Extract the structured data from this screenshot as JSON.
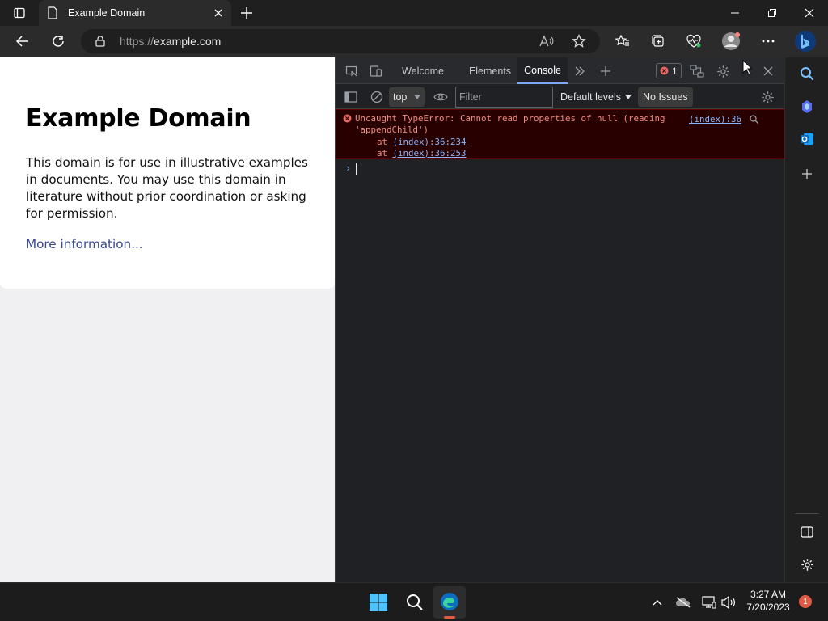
{
  "browser": {
    "tab_title": "Example Domain",
    "url_protocol": "https://",
    "url_host": "example.com"
  },
  "page": {
    "heading": "Example Domain",
    "paragraph": "This domain is for use in illustrative examples in documents. You may use this domain in literature without prior coordination or asking for permission.",
    "link": "More information..."
  },
  "devtools": {
    "tabs": [
      {
        "label": "Welcome"
      },
      {
        "label": "Elements"
      },
      {
        "label": "Console",
        "active": true
      }
    ],
    "error_count": "1",
    "context": "top",
    "filter_placeholder": "Filter",
    "levels_label": "Default levels",
    "issues_label": "No Issues",
    "console": {
      "error_line1": "Uncaught TypeError: Cannot read properties of null (reading",
      "error_line2": "'appendChild')",
      "at_label": "at",
      "stack": [
        "(index):36:234",
        "(index):36:253"
      ],
      "source_link": "(index):36"
    }
  },
  "taskbar": {
    "time": "3:27 AM",
    "date": "7/20/2023",
    "notification_count": "1"
  },
  "colors": {
    "error_bg": "#290000",
    "error_text": "#f28b82",
    "link": "#8ab4f8",
    "accent": "#7cacf8",
    "edge_blue": "#0f6cbd"
  }
}
